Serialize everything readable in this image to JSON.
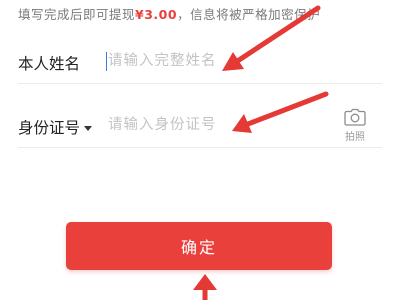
{
  "notice": {
    "prefix": "填写完成后即可提现",
    "amount": "¥3.00",
    "suffix": "，信息将被严格加密保护"
  },
  "form": {
    "name": {
      "label": "本人姓名",
      "placeholder": "请输入完整姓名"
    },
    "id_number": {
      "label": "身份证号",
      "placeholder": "请输入身份证号"
    },
    "camera_caption": "拍照"
  },
  "confirm_button": {
    "label": "确定"
  },
  "colors": {
    "accent": "#e9403c",
    "annotation_arrow": "#e53935"
  },
  "icons": {
    "camera": "camera-icon",
    "id_type_dropdown": "caret-down-icon"
  }
}
